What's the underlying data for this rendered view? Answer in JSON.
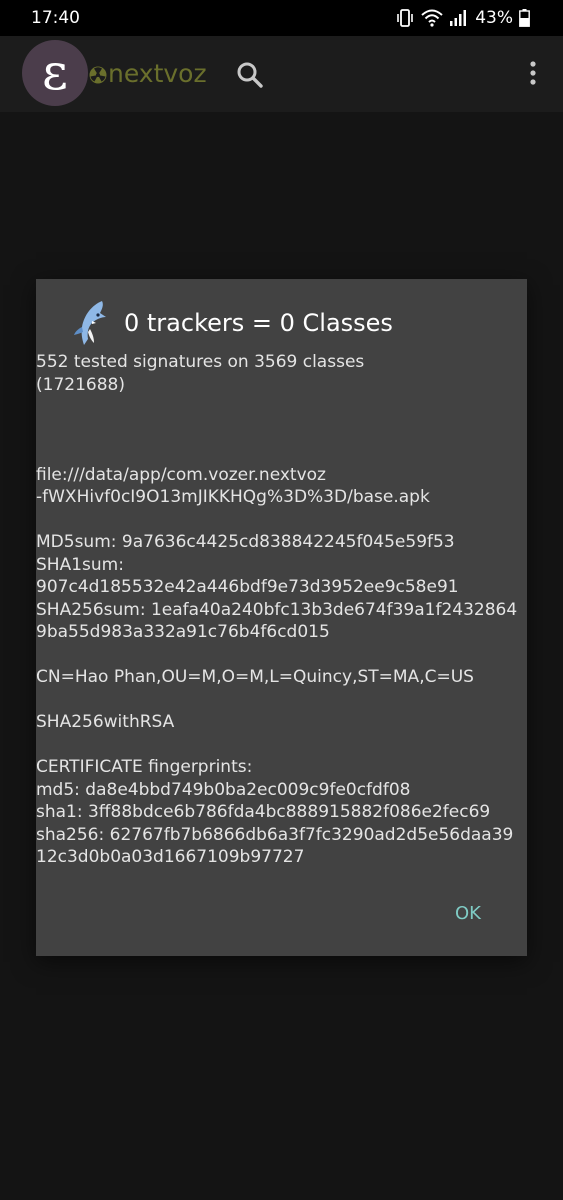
{
  "status_bar": {
    "time": "17:40",
    "battery_percent": "43%",
    "icons": [
      "vibrate-icon",
      "wifi-icon",
      "signal-icon",
      "battery-icon"
    ]
  },
  "app_bar": {
    "logo_letter": "ε",
    "title": "nextvoz",
    "icons": [
      "radiation-icon",
      "search-icon",
      "overflow-menu-icon"
    ]
  },
  "dialog": {
    "icon": "shark-icon",
    "title": "0 trackers = 0 Classes",
    "message": "552 tested signatures on 3569 classes\n(1721688)\n\n\n\nfile:///data/app/com.vozer.nextvoz\n-fWXHivf0cI9O13mJIKKHQg%3D%3D/base.apk\n\nMD5sum: 9a7636c4425cd838842245f045e59f53\nSHA1sum:\n907c4d185532e42a446bdf9e73d3952ee9c58e91\nSHA256sum: 1eafa40a240bfc13b3de674f39a1f2432864\n9ba55d983a332a91c76b4f6cd015\n\nCN=Hao Phan,OU=M,O=M,L=Quincy,ST=MA,C=US\n\nSHA256withRSA\n\nCERTIFICATE fingerprints:\nmd5: da8e4bbd749b0ba2ec009c9fe0cfdf08\nsha1: 3ff88bdce6b786fda4bc888915882f086e2fec69\nsha256: 62767fb7b6866db6a3f7fc3290ad2d5e56daa39\n12c3d0b0a03d1667109b97727",
    "ok_label": "OK"
  },
  "colors": {
    "background": "#151515",
    "dialog_background": "#424242",
    "accent": "#7fcbc4",
    "app_title": "#6a6f2c"
  }
}
